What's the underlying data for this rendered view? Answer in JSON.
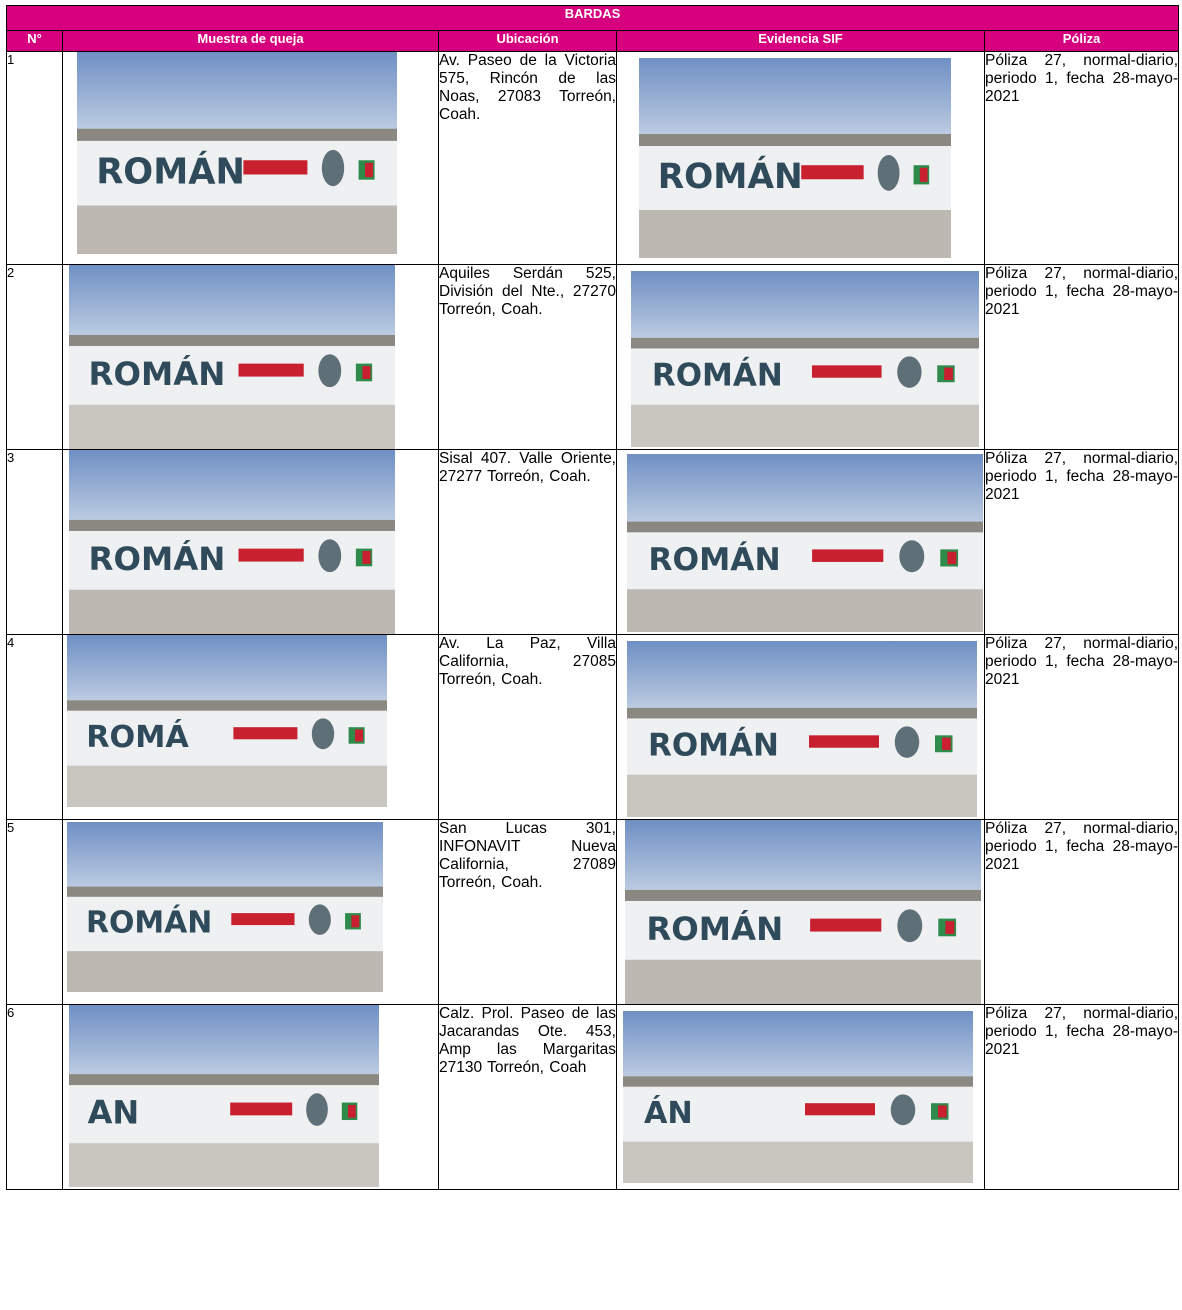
{
  "table": {
    "title": "BARDAS",
    "headers": [
      "N°",
      "Muestra de queja",
      "Ubicación",
      "Evidencia SIF",
      "Póliza"
    ],
    "rows": [
      {
        "n": "1",
        "ubicacion": "Av. Paseo de la Victoria 575, Rincón de las Noas, 27083 Torreón, Coah.",
        "poliza": "Póliza 27, normal-diario, periodo 1, fecha 28-mayo-2021"
      },
      {
        "n": "2",
        "ubicacion": "Aquiles Serdán 525, División del Nte., 27270 Torreón, Coah.",
        "poliza": "Póliza 27, normal-diario, periodo 1, fecha 28-mayo-2021"
      },
      {
        "n": "3",
        "ubicacion": "Sisal 407. Valle Oriente, 27277 Torreón, Coah.",
        "poliza": "Póliza 27, normal-diario, periodo 1, fecha 28-mayo-2021"
      },
      {
        "n": "4",
        "ubicacion": "Av. La Paz, Villa California, 27085 Torreón, Coah.",
        "poliza": "Póliza 27, normal-diario, periodo 1, fecha 28-mayo-2021"
      },
      {
        "n": "5",
        "ubicacion": "San Lucas 301, INFONAVIT Nueva California, 27089 Torreón, Coah.",
        "poliza": "Póliza 27, normal-diario, periodo 1, fecha 28-mayo-2021"
      },
      {
        "n": "6",
        "ubicacion": "Calz. Prol. Paseo de las Jacarandas Ote. 453, Amp las Margaritas 27130 Torreón, Coah",
        "poliza": "Póliza 27, normal-diario, periodo 1, fecha 28-mayo-2021"
      }
    ]
  },
  "photos": {
    "wall_text": "ROMÁN",
    "complaint_wall_texts": [
      "ROMÁN",
      "ROMÁN",
      "ROMÁN",
      "ROMÁ",
      "ROMÁN",
      "AN"
    ],
    "sif_wall_texts": [
      "ROMÁN",
      "ROMÁN",
      "ROMÁN",
      "ROMÁN",
      "ROMÁN",
      "ÁN"
    ]
  },
  "colors": {
    "header_bg": "#d6007f",
    "header_text": "#ffffff",
    "banner_red": "#c8202e",
    "wall_letters": "#2f4a5a"
  }
}
